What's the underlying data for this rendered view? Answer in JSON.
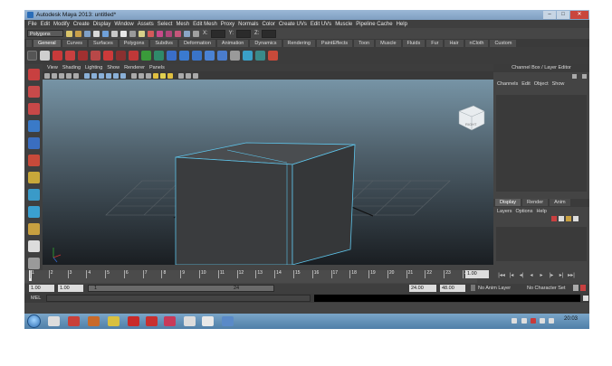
{
  "window": {
    "title": "Autodesk Maya 2013: untitled*",
    "min": "–",
    "max": "□",
    "close": "✕"
  },
  "menubar": [
    "File",
    "Edit",
    "Modify",
    "Create",
    "Display",
    "Window",
    "Assets",
    "Select",
    "Mesh",
    "Edit Mesh",
    "Proxy",
    "Normals",
    "Color",
    "Create UVs",
    "Edit UVs",
    "Muscle",
    "Pipeline Cache",
    "Help"
  ],
  "statusline": {
    "mode": "Polygons",
    "field_x": "X:",
    "field_y": "Y:",
    "field_z": "Z:"
  },
  "shelf_tabs": [
    "General",
    "Curves",
    "Surfaces",
    "Polygons",
    "Subdivs",
    "Deformation",
    "Animation",
    "Dynamics",
    "Rendering",
    "PaintEffects",
    "Toon",
    "Muscle",
    "Fluids",
    "Fur",
    "Hair",
    "nCloth",
    "Custom"
  ],
  "viewport": {
    "menu": [
      "View",
      "Shading",
      "Lighting",
      "Show",
      "Renderer",
      "Panels"
    ],
    "viewcube_label": "RIGHT"
  },
  "channelbox": {
    "title": "Channel Box / Layer Editor",
    "menu": [
      "Channels",
      "Edit",
      "Object",
      "Show"
    ]
  },
  "layer_editor": {
    "tabs": [
      "Display",
      "Render",
      "Anim"
    ],
    "menu": [
      "Layers",
      "Options",
      "Help"
    ]
  },
  "timeslider": {
    "ticks": [
      "1",
      "2",
      "3",
      "4",
      "5",
      "6",
      "7",
      "8",
      "9",
      "10",
      "11",
      "12",
      "13",
      "14",
      "15",
      "16",
      "17",
      "18",
      "19",
      "20",
      "21",
      "22",
      "23",
      "24"
    ],
    "current_frame": "1.00"
  },
  "playback": [
    "|◂◂",
    "|◂",
    "◂|",
    "◂",
    "▸",
    "|▸",
    "▸|",
    "▸▸|"
  ],
  "rangebar": {
    "start": "1.00",
    "playback_start": "1.00",
    "slider_start": "1",
    "slider_end": "24",
    "playback_end": "24.00",
    "end": "48.00",
    "anim_layer": "No Anim Layer",
    "character_set": "No Character Set"
  },
  "cmdline": {
    "label": "MEL"
  },
  "taskbar": {
    "clock": "20:03"
  }
}
